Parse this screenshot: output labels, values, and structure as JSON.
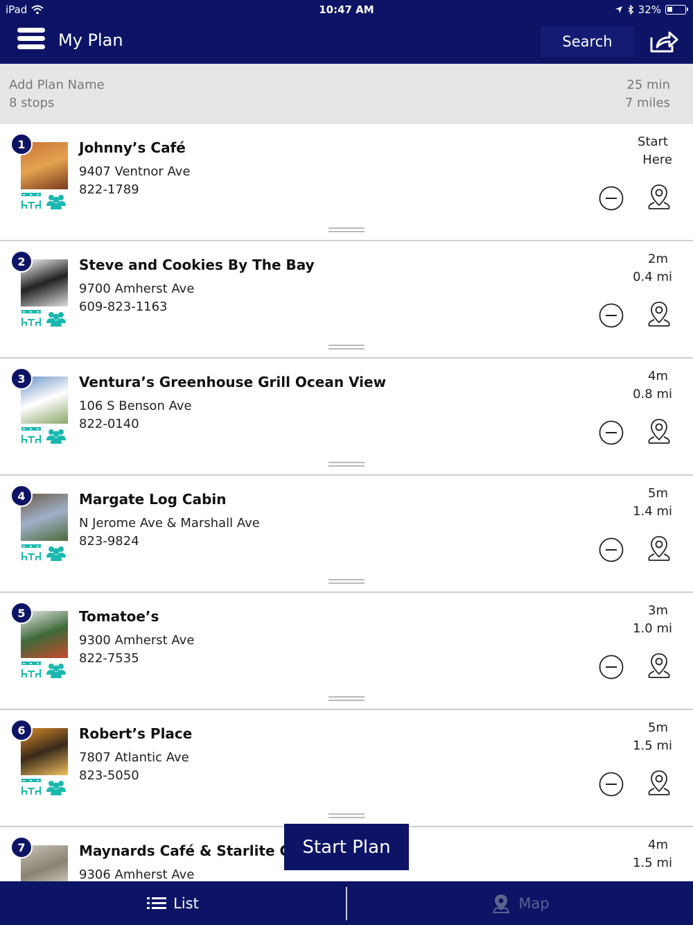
{
  "status_bar": {
    "device": "iPad",
    "time": "10:47 AM",
    "battery": "32%",
    "battery_level": 0.32
  },
  "header": {
    "title": "My Plan",
    "search_label": "Search"
  },
  "plan": {
    "name_placeholder": "Add Plan Name",
    "stops_count": "8 stops",
    "total_time": "25 min",
    "total_distance": "7 miles"
  },
  "stops": [
    {
      "number": "1",
      "name": "Johnny’s Café",
      "address": "9407 Ventnor Ave",
      "phone": "822-1789",
      "time": "Start",
      "distance": "Here"
    },
    {
      "number": "2",
      "name": "Steve and Cookies By The Bay",
      "address": "9700 Amherst Ave",
      "phone": "609-823-1163",
      "time": "2m",
      "distance": "0.4 mi"
    },
    {
      "number": "3",
      "name": "Ventura’s Greenhouse Grill Ocean View",
      "address": "106 S Benson Ave",
      "phone": "822-0140",
      "time": "4m",
      "distance": "0.8 mi"
    },
    {
      "number": "4",
      "name": "Margate Log Cabin",
      "address": "N Jerome Ave & Marshall Ave",
      "phone": "823-9824",
      "time": "5m",
      "distance": "1.4 mi"
    },
    {
      "number": "5",
      "name": "Tomatoe’s",
      "address": "9300 Amherst Ave",
      "phone": "822-7535",
      "time": "3m",
      "distance": "1.0 mi"
    },
    {
      "number": "6",
      "name": "Robert’s Place",
      "address": "7807 Atlantic Ave",
      "phone": "823-5050",
      "time": "5m",
      "distance": "1.5 mi"
    },
    {
      "number": "7",
      "name": "Maynards Café & Starlite Gar",
      "address": "9306 Amherst Ave",
      "phone": "",
      "time": "4m",
      "distance": "1.5 mi"
    }
  ],
  "start_plan_label": "Start Plan",
  "tabs": {
    "list_label": "List",
    "map_label": "Map"
  },
  "colors": {
    "primary": "#0d1466",
    "accent_teal": "#1bb8b0",
    "divider": "#cfcfcf"
  },
  "icons": [
    "menu-icon",
    "share-icon",
    "remove-icon",
    "map-pin-icon",
    "outdoor-seating-icon",
    "group-icon",
    "list-icon",
    "map-icon",
    "drag-handle-icon"
  ]
}
